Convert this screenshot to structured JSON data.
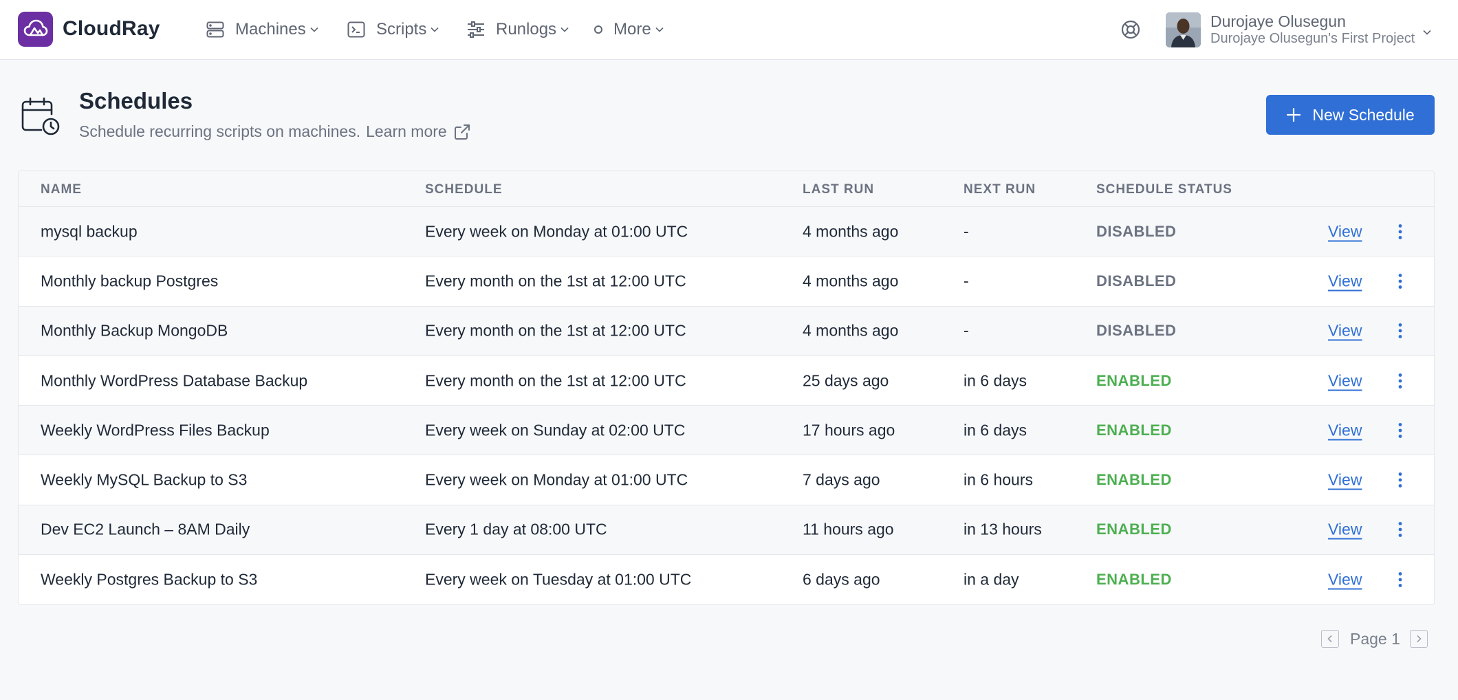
{
  "app": {
    "name": "CloudRay"
  },
  "nav": {
    "items": [
      {
        "label": "Machines",
        "icon": "server-icon"
      },
      {
        "label": "Scripts",
        "icon": "terminal-icon"
      },
      {
        "label": "Runlogs",
        "icon": "sliders-icon"
      },
      {
        "label": "More",
        "icon": "circle-icon"
      }
    ]
  },
  "user": {
    "name": "Durojaye Olusegun",
    "project": "Durojaye Olusegun's First Project"
  },
  "page": {
    "title": "Schedules",
    "subtitle": "Schedule recurring scripts on machines.",
    "learn_more": "Learn more",
    "new_button": "New Schedule"
  },
  "table": {
    "headers": [
      "NAME",
      "SCHEDULE",
      "LAST RUN",
      "NEXT RUN",
      "SCHEDULE STATUS"
    ],
    "view_label": "View",
    "rows": [
      {
        "name": "mysql backup",
        "schedule": "Every week on Monday at 01:00 UTC",
        "last_run": "4 months ago",
        "next_run": "-",
        "status": "DISABLED"
      },
      {
        "name": "Monthly backup Postgres",
        "schedule": "Every month on the 1st at 12:00 UTC",
        "last_run": "4 months ago",
        "next_run": "-",
        "status": "DISABLED"
      },
      {
        "name": "Monthly Backup MongoDB",
        "schedule": "Every month on the 1st at 12:00 UTC",
        "last_run": "4 months ago",
        "next_run": "-",
        "status": "DISABLED"
      },
      {
        "name": "Monthly WordPress Database Backup",
        "schedule": "Every month on the 1st at 12:00 UTC",
        "last_run": "25 days ago",
        "next_run": "in 6 days",
        "status": "ENABLED"
      },
      {
        "name": "Weekly WordPress Files Backup",
        "schedule": "Every week on Sunday at 02:00 UTC",
        "last_run": "17 hours ago",
        "next_run": "in 6 days",
        "status": "ENABLED"
      },
      {
        "name": "Weekly MySQL Backup to S3",
        "schedule": "Every week on Monday at 01:00 UTC",
        "last_run": "7 days ago",
        "next_run": "in 6 hours",
        "status": "ENABLED"
      },
      {
        "name": "Dev EC2 Launch – 8AM Daily",
        "schedule": "Every 1 day at 08:00 UTC",
        "last_run": "11 hours ago",
        "next_run": "in 13 hours",
        "status": "ENABLED"
      },
      {
        "name": "Weekly Postgres Backup to S3",
        "schedule": "Every week on Tuesday at 01:00 UTC",
        "last_run": "6 days ago",
        "next_run": "in a day",
        "status": "ENABLED"
      }
    ]
  },
  "pagination": {
    "label": "Page 1"
  },
  "colors": {
    "brand": "#6b2fa3",
    "primary": "#2f6fd6",
    "enabled": "#4caf50",
    "disabled": "#6b7280"
  }
}
